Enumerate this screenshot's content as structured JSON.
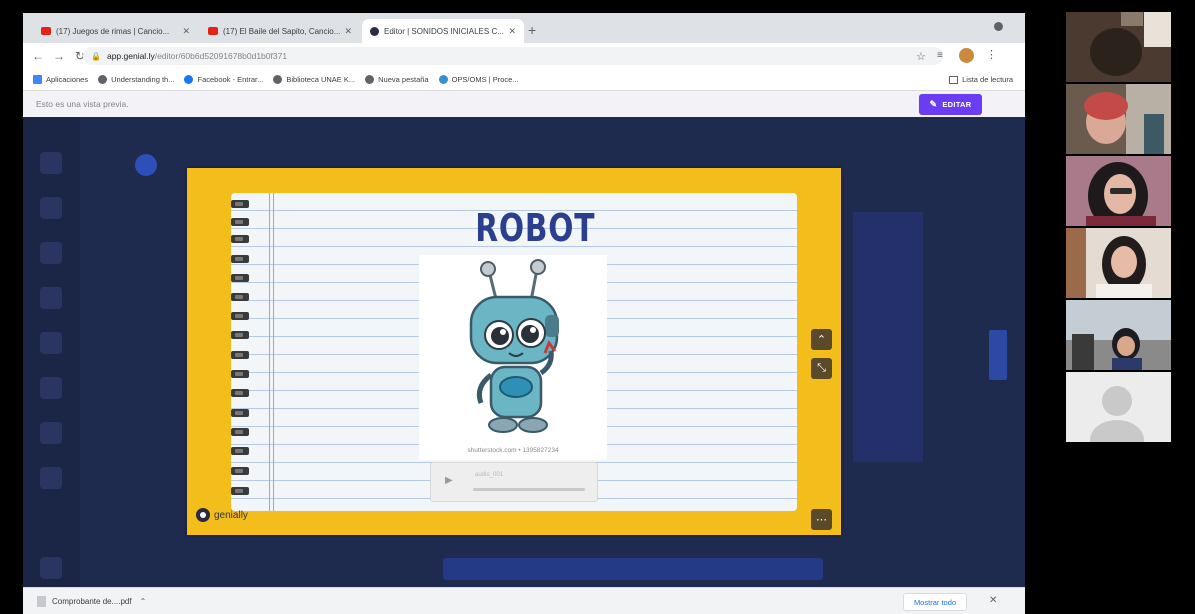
{
  "browser": {
    "tabs": [
      {
        "label": "(17) Juegos de rimas | Cancio...",
        "icon": "youtube-icon"
      },
      {
        "label": "(17) El Baile del Sapito, Cancio...",
        "icon": "youtube-icon"
      },
      {
        "label": "Editor | SONIDOS INICIALES C...",
        "icon": "genially-icon",
        "active": true
      }
    ],
    "address_host": "app.genial.ly",
    "address_path": "/editor/60b6d52091678b0d1b0f371",
    "bookmarks": [
      {
        "label": "Aplicaciones",
        "icon": "apps-icon"
      },
      {
        "label": "Understanding th...",
        "icon": "globe-icon"
      },
      {
        "label": "Facebook - Entrar...",
        "icon": "facebook-icon"
      },
      {
        "label": "Biblioteca UNAE K...",
        "icon": "globe-icon"
      },
      {
        "label": "Nueva pestaña",
        "icon": "globe-icon"
      },
      {
        "label": "OPS/OMS | Proce...",
        "icon": "globe-icon"
      }
    ],
    "reading_list": "Lista de lectura"
  },
  "preview": {
    "notice": "Esto es una vista previa.",
    "edit_button": "EDITAR"
  },
  "slide": {
    "title": "ROBOT",
    "image_watermark": "shutterstock.com • 1395827234",
    "audio_name": "audio_001",
    "logo_text": "genially"
  },
  "downloads": {
    "file": "Comprobante de....pdf",
    "show_all": "Mostrar todo"
  },
  "colors": {
    "slide_frame": "#f3be1b",
    "title": "#2b3f8e",
    "edit_button": "#6a3df5",
    "editor_bg": "#1f2a4f"
  }
}
